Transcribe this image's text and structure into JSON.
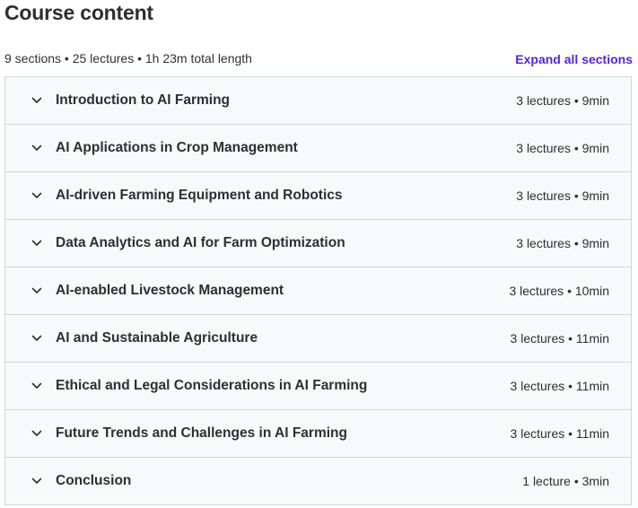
{
  "header": {
    "title": "Course content"
  },
  "summary": {
    "text": "9 sections • 25 lectures • 1h 23m total length",
    "expand_label": "Expand all sections"
  },
  "colors": {
    "accent": "#5624d0",
    "section_bg": "#f7f9fa",
    "border": "#d1d7dc",
    "text": "#2d2f31"
  },
  "sections": [
    {
      "title": "Introduction to AI Farming",
      "info": "3 lectures • 9min",
      "icon": "chevron-down-icon"
    },
    {
      "title": "AI Applications in Crop Management",
      "info": "3 lectures • 9min",
      "icon": "chevron-down-icon"
    },
    {
      "title": "AI-driven Farming Equipment and Robotics",
      "info": "3 lectures • 9min",
      "icon": "chevron-down-icon"
    },
    {
      "title": "Data Analytics and AI for Farm Optimization",
      "info": "3 lectures • 9min",
      "icon": "chevron-down-icon"
    },
    {
      "title": "AI-enabled Livestock Management",
      "info": "3 lectures • 10min",
      "icon": "chevron-down-icon"
    },
    {
      "title": "AI and Sustainable Agriculture",
      "info": "3 lectures • 11min",
      "icon": "chevron-down-icon"
    },
    {
      "title": "Ethical and Legal Considerations in AI Farming",
      "info": "3 lectures • 11min",
      "icon": "chevron-down-icon"
    },
    {
      "title": "Future Trends and Challenges in AI Farming",
      "info": "3 lectures • 11min",
      "icon": "chevron-down-icon"
    },
    {
      "title": "Conclusion",
      "info": "1 lecture • 3min",
      "icon": "chevron-down-icon"
    }
  ]
}
